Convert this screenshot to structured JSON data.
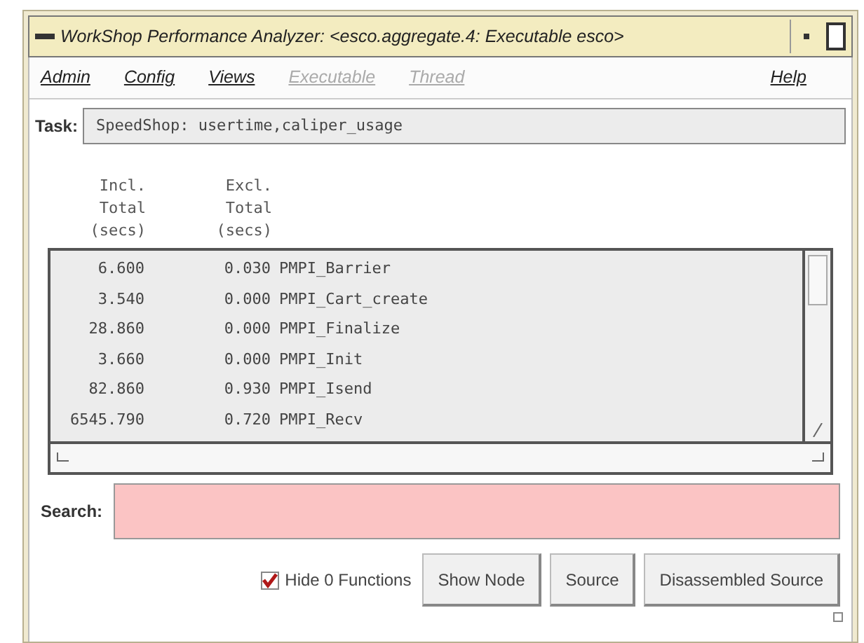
{
  "window": {
    "title": "WorkShop Performance Analyzer: <esco.aggregate.4: Executable esco>"
  },
  "menu": [
    {
      "label": "Admin",
      "disabled": false
    },
    {
      "label": "Config",
      "disabled": false
    },
    {
      "label": "Views",
      "disabled": false
    },
    {
      "label": "Executable",
      "disabled": true
    },
    {
      "label": "Thread",
      "disabled": true
    },
    {
      "label": "Help",
      "disabled": false
    }
  ],
  "task": {
    "label": "Task:",
    "value": "SpeedShop: usertime,caliper_usage"
  },
  "table": {
    "columns": [
      "Incl. Total (secs)",
      "Excl. Total (secs)"
    ],
    "rows": [
      [
        "6.600",
        "0.030",
        "PMPI_Barrier"
      ],
      [
        "3.540",
        "0.000",
        "PMPI_Cart_create"
      ],
      [
        "28.860",
        "0.000",
        "PMPI_Finalize"
      ],
      [
        "3.660",
        "0.000",
        "PMPI_Init"
      ],
      [
        "82.860",
        "0.930",
        "PMPI_Isend"
      ],
      [
        "6545.790",
        "0.720",
        "PMPI_Recv"
      ]
    ]
  },
  "search": {
    "label": "Search:"
  },
  "hide_zero": {
    "label": "Hide 0 Functions",
    "checked": true
  },
  "buttons": [
    "Show Node",
    "Source",
    "Disassembled Source"
  ]
}
